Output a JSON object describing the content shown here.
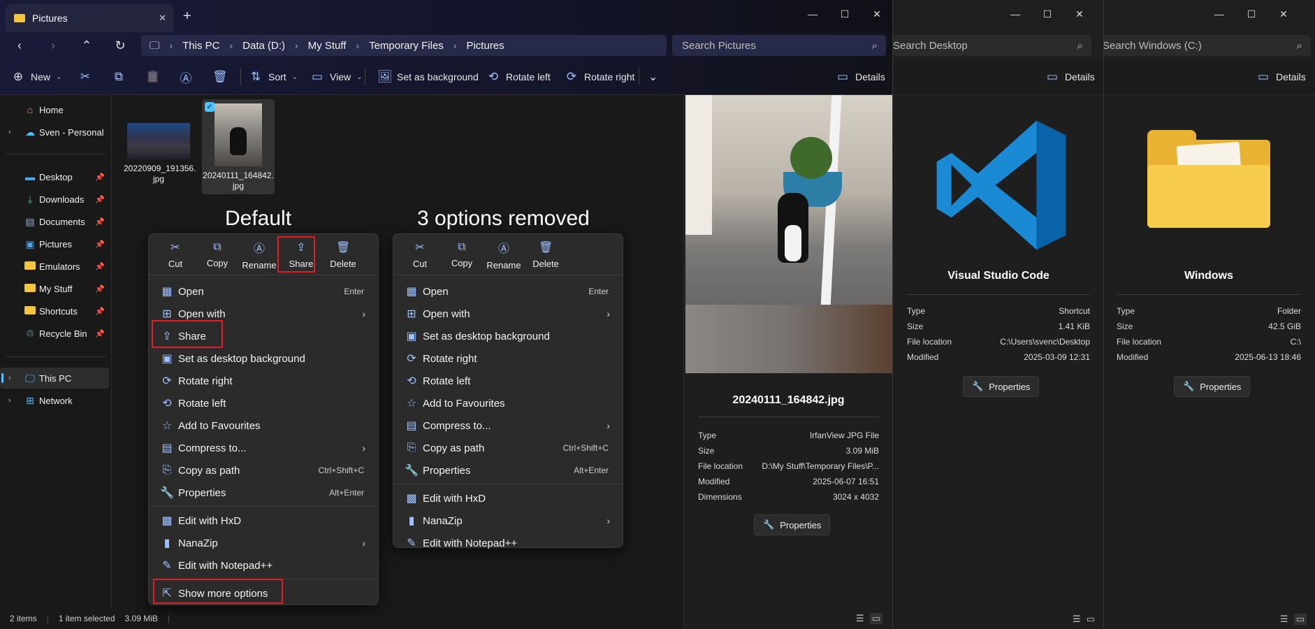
{
  "main": {
    "tab_title": "Pictures",
    "breadcrumbs": [
      "This PC",
      "Data (D:)",
      "My Stuff",
      "Temporary Files",
      "Pictures"
    ],
    "search_placeholder": "Search Pictures",
    "toolbar": {
      "new_label": "New",
      "sort_label": "Sort",
      "view_label": "View",
      "set_bg_label": "Set as background",
      "rotate_left_label": "Rotate left",
      "rotate_right_label": "Rotate right",
      "details_label": "Details"
    },
    "sidebar": [
      {
        "label": "Home",
        "icon": "home-icon"
      },
      {
        "label": "Sven - Personal",
        "icon": "cloud-icon"
      },
      {
        "label": "Desktop",
        "icon": "desktop-icon"
      },
      {
        "label": "Downloads",
        "icon": "download-icon"
      },
      {
        "label": "Documents",
        "icon": "document-icon"
      },
      {
        "label": "Pictures",
        "icon": "picture-icon"
      },
      {
        "label": "Emulators",
        "icon": "folder-icon"
      },
      {
        "label": "My Stuff",
        "icon": "folder-icon"
      },
      {
        "label": "Shortcuts",
        "icon": "folder-icon"
      },
      {
        "label": "Recycle Bin",
        "icon": "recycle-bin-icon"
      },
      {
        "label": "This PC",
        "icon": "pc-icon"
      },
      {
        "label": "Network",
        "icon": "network-icon"
      }
    ],
    "files": [
      {
        "name_line1": "20220909_191356.",
        "name_line2": "jpg"
      },
      {
        "name_line1": "20240111_164842.",
        "name_line2": "jpg"
      }
    ],
    "status": {
      "items": "2 items",
      "selected": "1 item selected",
      "size": "3.09 MiB"
    }
  },
  "overlay": {
    "heading_default": "Default",
    "heading_removed": "3 options removed"
  },
  "menu_default": {
    "quick": [
      "Cut",
      "Copy",
      "Rename",
      "Share",
      "Delete"
    ],
    "items": [
      {
        "label": "Open",
        "shortcut": "Enter"
      },
      {
        "label": "Open with",
        "shortcut": ""
      },
      {
        "label": "Share",
        "shortcut": ""
      },
      {
        "label": "Set as desktop background",
        "shortcut": ""
      },
      {
        "label": "Rotate right",
        "shortcut": ""
      },
      {
        "label": "Rotate left",
        "shortcut": ""
      },
      {
        "label": "Add to Favourites",
        "shortcut": ""
      },
      {
        "label": "Compress to...",
        "shortcut": ""
      },
      {
        "label": "Copy as path",
        "shortcut": "Ctrl+Shift+C"
      },
      {
        "label": "Properties",
        "shortcut": "Alt+Enter"
      },
      {
        "label": "Edit with HxD",
        "shortcut": ""
      },
      {
        "label": "NanaZip",
        "shortcut": ""
      },
      {
        "label": "Edit with Notepad++",
        "shortcut": ""
      },
      {
        "label": "Show more options",
        "shortcut": ""
      }
    ]
  },
  "menu_removed": {
    "quick": [
      "Cut",
      "Copy",
      "Rename",
      "Delete"
    ],
    "items": [
      {
        "label": "Open",
        "shortcut": "Enter"
      },
      {
        "label": "Open with",
        "shortcut": ""
      },
      {
        "label": "Set as desktop background",
        "shortcut": ""
      },
      {
        "label": "Rotate right",
        "shortcut": ""
      },
      {
        "label": "Rotate left",
        "shortcut": ""
      },
      {
        "label": "Add to Favourites",
        "shortcut": ""
      },
      {
        "label": "Compress to...",
        "shortcut": ""
      },
      {
        "label": "Copy as path",
        "shortcut": "Ctrl+Shift+C"
      },
      {
        "label": "Properties",
        "shortcut": "Alt+Enter"
      },
      {
        "label": "Edit with HxD",
        "shortcut": ""
      },
      {
        "label": "NanaZip",
        "shortcut": ""
      },
      {
        "label": "Edit with Notepad++",
        "shortcut": ""
      }
    ]
  },
  "preview": {
    "filename": "20240111_164842.jpg",
    "rows": [
      {
        "k": "Type",
        "v": "IrfanView JPG File"
      },
      {
        "k": "Size",
        "v": "3.09 MiB"
      },
      {
        "k": "File location",
        "v": "D:\\My Stuff\\Temporary Files\\P..."
      },
      {
        "k": "Modified",
        "v": "2025-06-07 16:51"
      },
      {
        "k": "Dimensions",
        "v": "3024 x 4032"
      }
    ],
    "properties_label": "Properties"
  },
  "win2": {
    "search_placeholder": "Search Desktop",
    "details_label": "Details",
    "name": "Visual Studio Code",
    "rows": [
      {
        "k": "Type",
        "v": "Shortcut"
      },
      {
        "k": "Size",
        "v": "1.41 KiB"
      },
      {
        "k": "File location",
        "v": "C:\\Users\\svenc\\Desktop"
      },
      {
        "k": "Modified",
        "v": "2025-03-09 12:31"
      }
    ],
    "properties_label": "Properties"
  },
  "win3": {
    "search_placeholder": "Search Windows (C:)",
    "details_label": "Details",
    "name": "Windows",
    "rows": [
      {
        "k": "Type",
        "v": "Folder"
      },
      {
        "k": "Size",
        "v": "42.5 GiB"
      },
      {
        "k": "File location",
        "v": "C:\\"
      },
      {
        "k": "Modified",
        "v": "2025-06-13 18:46"
      }
    ],
    "properties_label": "Properties"
  },
  "colors": {
    "accent": "#4cc2ff",
    "highlight": "#e51c23",
    "vscode": "#0a7acc",
    "folder": "#f5c542"
  }
}
